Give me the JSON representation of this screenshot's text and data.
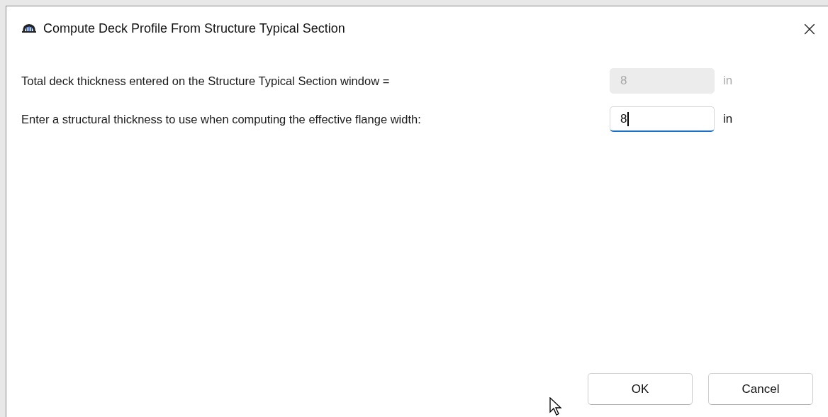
{
  "window": {
    "title": "Compute Deck Profile From Structure Typical Section",
    "close": "×"
  },
  "fields": [
    {
      "label": "Total deck thickness entered on the Structure Typical Section window =",
      "value": "8",
      "unit": "in",
      "disabled": true,
      "focused": false
    },
    {
      "label": "Enter a structural thickness to use when computing the effective flange width:",
      "value": "8",
      "unit": "in",
      "disabled": false,
      "focused": true
    }
  ],
  "buttons": [
    "OK",
    "Cancel"
  ]
}
